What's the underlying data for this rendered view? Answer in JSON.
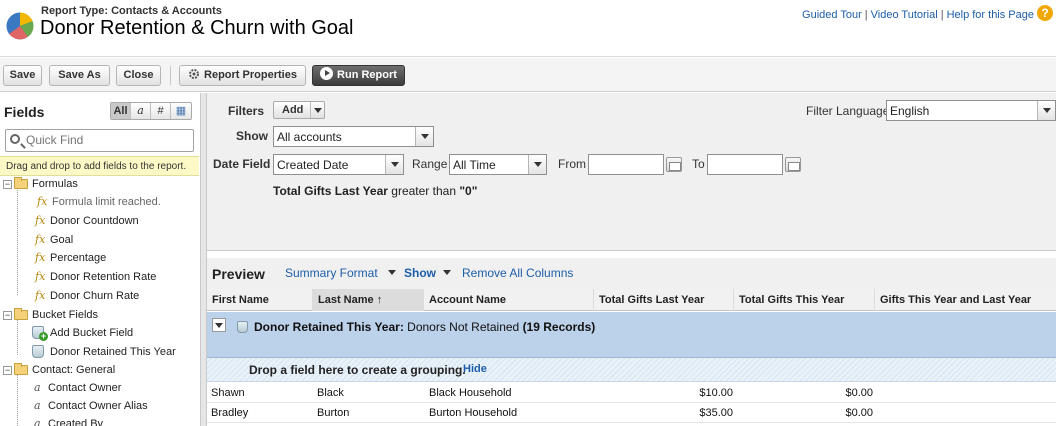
{
  "header": {
    "report_type": "Report Type: Contacts & Accounts",
    "title": "Donor Retention & Churn with Goal",
    "links": [
      "Guided Tour",
      "Video Tutorial",
      "Help for this Page"
    ],
    "separator": "|",
    "help_glyph": "?"
  },
  "toolbar": {
    "save": "Save",
    "save_as": "Save As",
    "close": "Close",
    "report_properties": "Report Properties",
    "run_report": "Run Report"
  },
  "fields_panel": {
    "title": "Fields",
    "filter_buttons": [
      "All",
      "a",
      "#",
      "▦"
    ],
    "active_filter": "All",
    "quick_find_placeholder": "Quick Find",
    "hint": "Drag and drop to add fields to the report.",
    "tree": [
      {
        "type": "folder",
        "label": "Formulas"
      },
      {
        "type": "fx",
        "label": "Formula limit reached.",
        "muted": true
      },
      {
        "type": "fx",
        "label": "Donor Countdown"
      },
      {
        "type": "fx",
        "label": "Goal"
      },
      {
        "type": "fx",
        "label": "Percentage"
      },
      {
        "type": "fx",
        "label": "Donor Retention Rate"
      },
      {
        "type": "fx",
        "label": "Donor Churn Rate"
      },
      {
        "type": "folder",
        "label": "Bucket Fields"
      },
      {
        "type": "bucket-add",
        "label": "Add Bucket Field"
      },
      {
        "type": "bucket",
        "label": "Donor Retained This Year"
      },
      {
        "type": "folder",
        "label": "Contact: General"
      },
      {
        "type": "alpha",
        "label": "Contact Owner"
      },
      {
        "type": "alpha",
        "label": "Contact Owner Alias"
      },
      {
        "type": "alpha",
        "label": "Created By"
      }
    ]
  },
  "filters": {
    "label": "Filters",
    "add": "Add",
    "filter_language_label": "Filter Language",
    "filter_language_value": "English",
    "show_label": "Show",
    "show_value": "All accounts",
    "date_field_label": "Date Field",
    "date_field_value": "Created Date",
    "range_label": "Range",
    "range_value": "All Time",
    "from_label": "From",
    "from_value": "",
    "to_label": "To",
    "to_value": "",
    "criteria_field": "Total Gifts Last Year",
    "criteria_operator": "greater than",
    "criteria_value": "\"0\""
  },
  "preview": {
    "title": "Preview",
    "summary_format": "Summary Format",
    "show": "Show",
    "remove_all_columns": "Remove All Columns",
    "columns": [
      "First Name",
      "Last Name ↑",
      "Account Name",
      "Total Gifts Last Year",
      "Total Gifts This Year",
      "Gifts This Year and Last Year"
    ],
    "sorted_column_index": 1,
    "group": {
      "field": "Donor Retained This Year:",
      "value": "Donors Not Retained",
      "count": "(19 Records)"
    },
    "drop_hint": "Drop a field here to create a grouping.",
    "hide": "Hide",
    "rows": [
      {
        "first": "Shawn",
        "last": "Black",
        "account": "Black Household",
        "last_year": "$10.00",
        "this_year": "$0.00",
        "both": ""
      },
      {
        "first": "Bradley",
        "last": "Burton",
        "account": "Burton Household",
        "last_year": "$35.00",
        "this_year": "$0.00",
        "both": ""
      }
    ]
  }
}
